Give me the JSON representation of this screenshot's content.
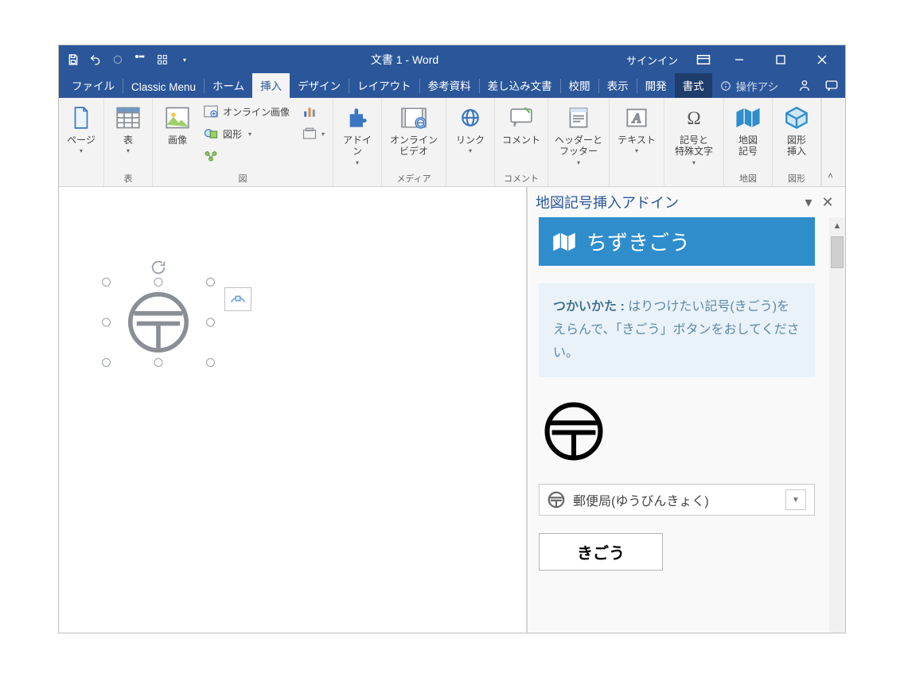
{
  "titlebar": {
    "title": "文書 1 - Word",
    "signin": "サインイン"
  },
  "tabs": {
    "file": "ファイル",
    "classic": "Classic Menu",
    "home": "ホーム",
    "insert": "挿入",
    "design": "デザイン",
    "layout": "レイアウト",
    "references": "参考資料",
    "mailings": "差し込み文書",
    "review": "校閲",
    "view": "表示",
    "developer": "開発",
    "format": "書式",
    "tell_me": "操作アシ"
  },
  "ribbon": {
    "pages_label": "ページ",
    "tables_group": "表",
    "table_btn": "表",
    "illustrations_group": "図",
    "pictures_btn": "画像",
    "online_pictures": "オンライン画像",
    "shapes": "図形",
    "chart": " ",
    "addins_btn": "アドイ\nン",
    "media_group": "メディア",
    "online_video": "オンライン\nビデオ",
    "links_btn": "リンク",
    "comment_group": "コメント",
    "comment_btn": "コメント",
    "header_footer": "ヘッダーと\nフッター",
    "text_btn": "テキスト",
    "symbols_btn": "記号と\n特殊文字",
    "map_group": "地図",
    "map_symbol": "地図\n記号",
    "shape_group": "図形",
    "shape_insert": "図形\n挿入"
  },
  "taskpane": {
    "title": "地図記号挿入アドイン",
    "header": "ちずきごう",
    "info_strong": "つかいかた :",
    "info_text": " はりつけたい記号(きごう)をえらんで、「きごう」ボタンをおしてください。",
    "select_label": "郵便局(ゆうびんきょく)",
    "button": "きごう"
  }
}
